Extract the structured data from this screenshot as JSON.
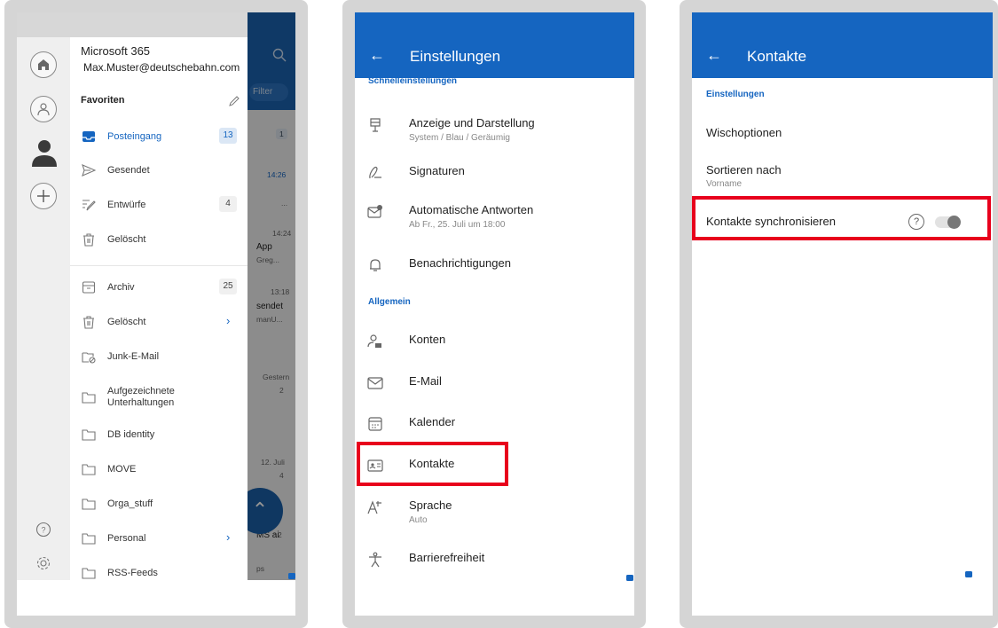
{
  "phone1": {
    "background": {
      "search_icon": "search-icon",
      "filter_label": "Filter",
      "badge_1": "1",
      "time_1": "14:26",
      "dots": "...",
      "time_2": "14:24",
      "text_app": "App",
      "text_greg": "Greg...",
      "time_3": "13:18",
      "text_sendet": "sendet",
      "text_manu": "manU...",
      "time_gestern": "Gestern",
      "badge_2": "2",
      "time_july": "12. Juli",
      "badge_4": "4",
      "text_msa": "MS ai",
      "badge_2b": "2",
      "text_ps": "ps"
    },
    "account": {
      "name": "Microsoft 365",
      "email": "Max.Muster@deutschebahn.com"
    },
    "favorites_title": "Favoriten",
    "favorites": [
      {
        "label": "Posteingang",
        "count": "13",
        "icon": "inbox-icon",
        "active": true
      },
      {
        "label": "Gesendet",
        "count": "",
        "icon": "send-icon"
      },
      {
        "label": "Entwürfe",
        "count": "4",
        "icon": "draft-icon"
      },
      {
        "label": "Gelöscht",
        "count": "",
        "icon": "trash-icon"
      }
    ],
    "folders": [
      {
        "label": "Archiv",
        "count": "25",
        "icon": "archive-icon"
      },
      {
        "label": "Gelöscht",
        "chevron": "›",
        "icon": "trash-icon"
      },
      {
        "label": "Junk-E-Mail",
        "icon": "junk-icon"
      },
      {
        "label": "Aufgezeichnete Unterhaltungen",
        "icon": "folder-icon"
      },
      {
        "label": "DB identity",
        "icon": "folder-icon"
      },
      {
        "label": "MOVE",
        "icon": "folder-icon"
      },
      {
        "label": "Orga_stuff",
        "icon": "folder-icon"
      },
      {
        "label": "Personal",
        "chevron": "›",
        "icon": "folder-icon"
      },
      {
        "label": "RSS-Feeds",
        "icon": "folder-icon"
      }
    ],
    "fab_icon": "chevron-up-icon"
  },
  "phone2": {
    "back": "←",
    "title": "Einstellungen",
    "section_quick": "Schnelleinstellungen",
    "section_general": "Allgemein",
    "quick_items": [
      {
        "title": "Anzeige und Darstellung",
        "sub": "System / Blau / Geräumig",
        "icon": "display-icon"
      },
      {
        "title": "Signaturen",
        "sub": "",
        "icon": "signature-icon"
      },
      {
        "title": "Automatische Antworten",
        "sub": "Ab Fr., 25. Juli um 18:00",
        "icon": "auto-reply-icon"
      },
      {
        "title": "Benachrichtigungen",
        "sub": "",
        "icon": "bell-icon"
      }
    ],
    "general_items": [
      {
        "title": "Konten",
        "sub": "",
        "icon": "accounts-icon"
      },
      {
        "title": "E-Mail",
        "sub": "",
        "icon": "mail-icon"
      },
      {
        "title": "Kalender",
        "sub": "",
        "icon": "calendar-icon"
      },
      {
        "title": "Kontakte",
        "sub": "",
        "icon": "contact-card-icon"
      },
      {
        "title": "Sprache",
        "sub": "Auto",
        "icon": "language-icon"
      },
      {
        "title": "Barrierefreiheit",
        "sub": "",
        "icon": "accessibility-icon"
      }
    ],
    "highlight_color": "#e8001c"
  },
  "phone3": {
    "back": "←",
    "title": "Kontakte",
    "section": "Einstellungen",
    "swipe": "Wischoptionen",
    "sort_title": "Sortieren nach",
    "sort_value": "Vorname",
    "sync_label": "Kontakte synchronisieren",
    "help": "?",
    "sync_enabled": false
  },
  "colors": {
    "accent": "#1565c0",
    "highlight": "#e8001c"
  }
}
